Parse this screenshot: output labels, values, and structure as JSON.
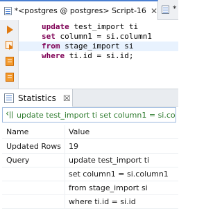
{
  "editor_tabs": [
    {
      "label": "*<postgres @ postgres> Script-16",
      "close": "✕"
    },
    {
      "label": "*"
    }
  ],
  "editor": {
    "code_lines": [
      {
        "keyword": "update",
        "rest": " test_import ti"
      },
      {
        "keyword": "set",
        "rest": " column1 = si.column1"
      },
      {
        "keyword": "from",
        "rest": " stage_import si"
      },
      {
        "keyword": "where",
        "rest": " ti.id = si.id;"
      }
    ]
  },
  "panel": {
    "tab_label": "Statistics",
    "tab_close": "☒"
  },
  "query_bar": {
    "text": "update test_import ti set column1 = si.col"
  },
  "stats_table": {
    "headers": {
      "name": "Name",
      "value": "Value"
    },
    "rows": [
      {
        "name": "Updated Rows",
        "value": "19"
      },
      {
        "name": "Query",
        "value": "update test_import ti"
      },
      {
        "name": "",
        "value": "set column1 = si.column1"
      },
      {
        "name": "",
        "value": "from stage_import si"
      },
      {
        "name": "",
        "value": "where ti.id = si.id"
      }
    ]
  },
  "colors": {
    "keyword": "#7f0055",
    "accent": "#4a7fd1",
    "toolbar_orange": "#e07a10",
    "query_green": "#2c7a2c",
    "current_line": "#e8f2fe"
  },
  "icons": {
    "editor_tab": "sql-script-icon",
    "toolbar": [
      "execute-statement-icon",
      "execute-script-icon",
      "explain-plan-icon",
      "load-plan-icon"
    ],
    "panel_tab": "statistics-icon",
    "query_bar": "sql-query-icon"
  }
}
